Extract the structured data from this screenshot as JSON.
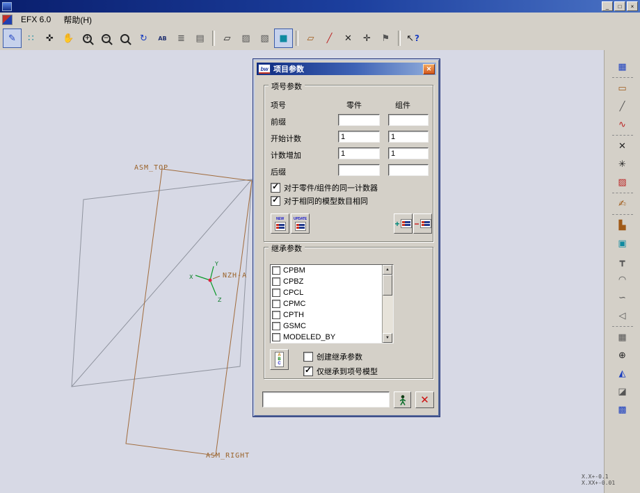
{
  "window": {
    "min": "_",
    "max": "□",
    "close": "×"
  },
  "menu": {
    "items": [
      "EFX 6.0",
      "帮助(H)"
    ]
  },
  "icons": {
    "pencil": "✎",
    "datum_points": "∷",
    "refs": "✜",
    "pan": "✋",
    "plus": "+",
    "minus": "−",
    "repaint": "↻",
    "saved_views": "AB",
    "layers": "≣",
    "view_manager": "▤",
    "wireframe": "▱",
    "hidden_line": "▨",
    "no_hidden": "▧",
    "shaded": "■",
    "plane_toggle": "▱",
    "axis_toggle": "╱",
    "point_toggle": "✕",
    "csys_toggle": "✛",
    "annotation_toggle": "⚑",
    "help_arrow": "↖",
    "help_q": "?",
    "close_x": "✕",
    "up_arrow": "▲",
    "down_arrow": "▼",
    "abc_a": "A",
    "abc_b": "B",
    "abc_c": "C",
    "r1": "▦",
    "r2": "▭",
    "r3": "╱",
    "r4": "∿",
    "r5": "✕",
    "r6": "✳",
    "r7": "▨",
    "r8": "✍",
    "r9": "▙",
    "r10": "▣",
    "r11": "┳",
    "r12": "◠",
    "r13": "∽",
    "r14": "◁",
    "r15": "▦",
    "r16": "⊕",
    "r17": "◭",
    "r18": "◪",
    "r19": "▩"
  },
  "canvas": {
    "asm_top": "ASM_TOP",
    "asm_right": "ASM_RIGHT",
    "csys_name": "NZH-A",
    "axis_x": "X",
    "axis_y": "Y",
    "axis_z": "Z",
    "note1": "X.X+-0.1",
    "note2": "X.XX+-0.01"
  },
  "dialog": {
    "logo": "bw",
    "title": "项目参数",
    "group1": {
      "title": "项号参数",
      "col_item": "项号",
      "col_part": "零件",
      "col_asm": "组件",
      "rows": [
        {
          "label": "前缀",
          "part": "",
          "asm": ""
        },
        {
          "label": "开始计数",
          "part": "1",
          "asm": "1"
        },
        {
          "label": "计数增加",
          "part": "1",
          "asm": "1"
        },
        {
          "label": "后缀",
          "part": "",
          "asm": ""
        }
      ],
      "check1": {
        "label": "对于零件/组件的同一计数器",
        "checked": "true"
      },
      "check2": {
        "label": "对于相同的模型数目相同",
        "checked": "true"
      },
      "buttons": {
        "new": "NEW",
        "update": "UPDATE"
      }
    },
    "group2": {
      "title": "继承参数",
      "items": [
        "CPBM",
        "CPBZ",
        "CPCL",
        "CPMC",
        "CPTH",
        "GSMC",
        "MODELED_BY"
      ],
      "check_create": {
        "label": "创建继承参数",
        "checked": "false"
      },
      "check_inherit": {
        "label": "仅继承到项号模型",
        "checked": "true"
      }
    },
    "input_value": ""
  }
}
